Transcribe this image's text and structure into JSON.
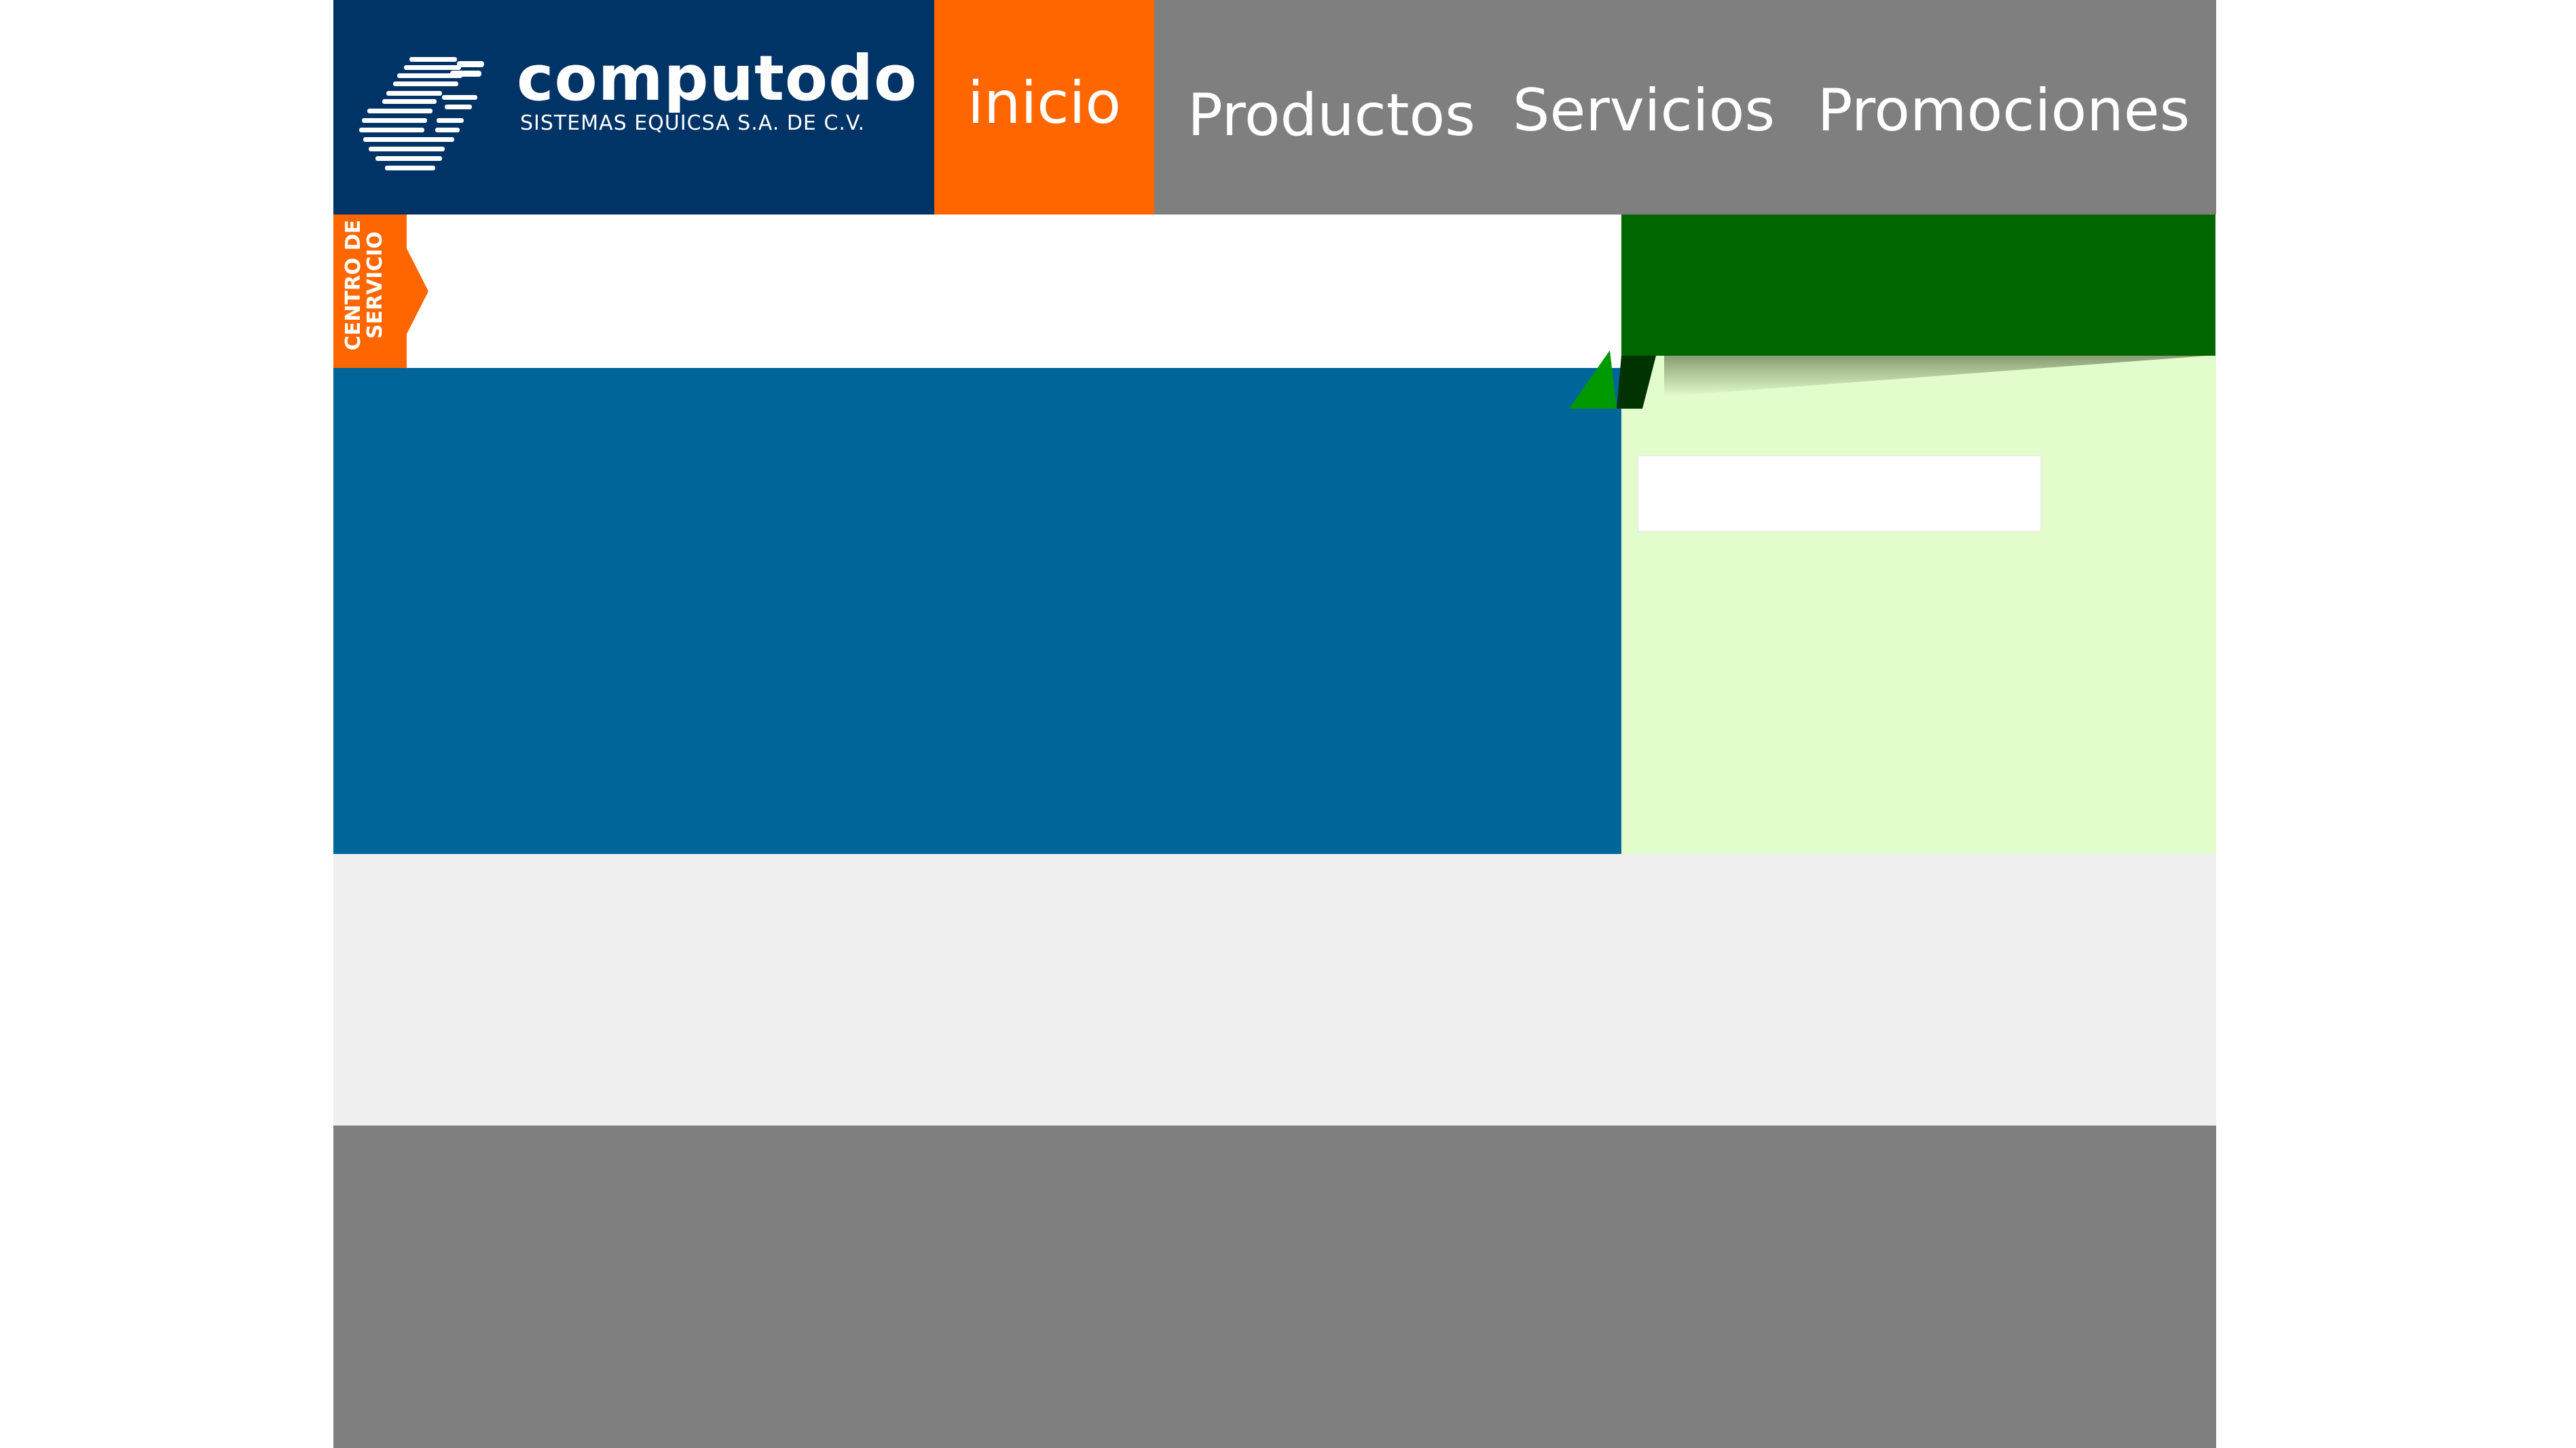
{
  "brand": {
    "name": "computodo",
    "subtitle": "SISTEMAS EQUICSA S.A. DE C.V.",
    "logo_icon": "running-figure-logo-icon"
  },
  "nav": {
    "items": [
      {
        "label": "inicio",
        "active": true
      },
      {
        "label": "Productos",
        "active": false
      },
      {
        "label": "Servicios",
        "active": false
      },
      {
        "label": "Promociones",
        "active": false
      }
    ]
  },
  "service_tag": {
    "line1": "CENTRO DE",
    "line2": "SERVICIO"
  },
  "search": {
    "value": "",
    "placeholder": ""
  },
  "colors": {
    "header_bg": "#7f7f7f",
    "logo_bg": "#003366",
    "accent_orange": "#ff6600",
    "dark_green": "#006600",
    "light_green": "#e3fccc",
    "blue_panel": "#006699",
    "grey_band": "#efefef",
    "footer": "#7f7f7f"
  }
}
